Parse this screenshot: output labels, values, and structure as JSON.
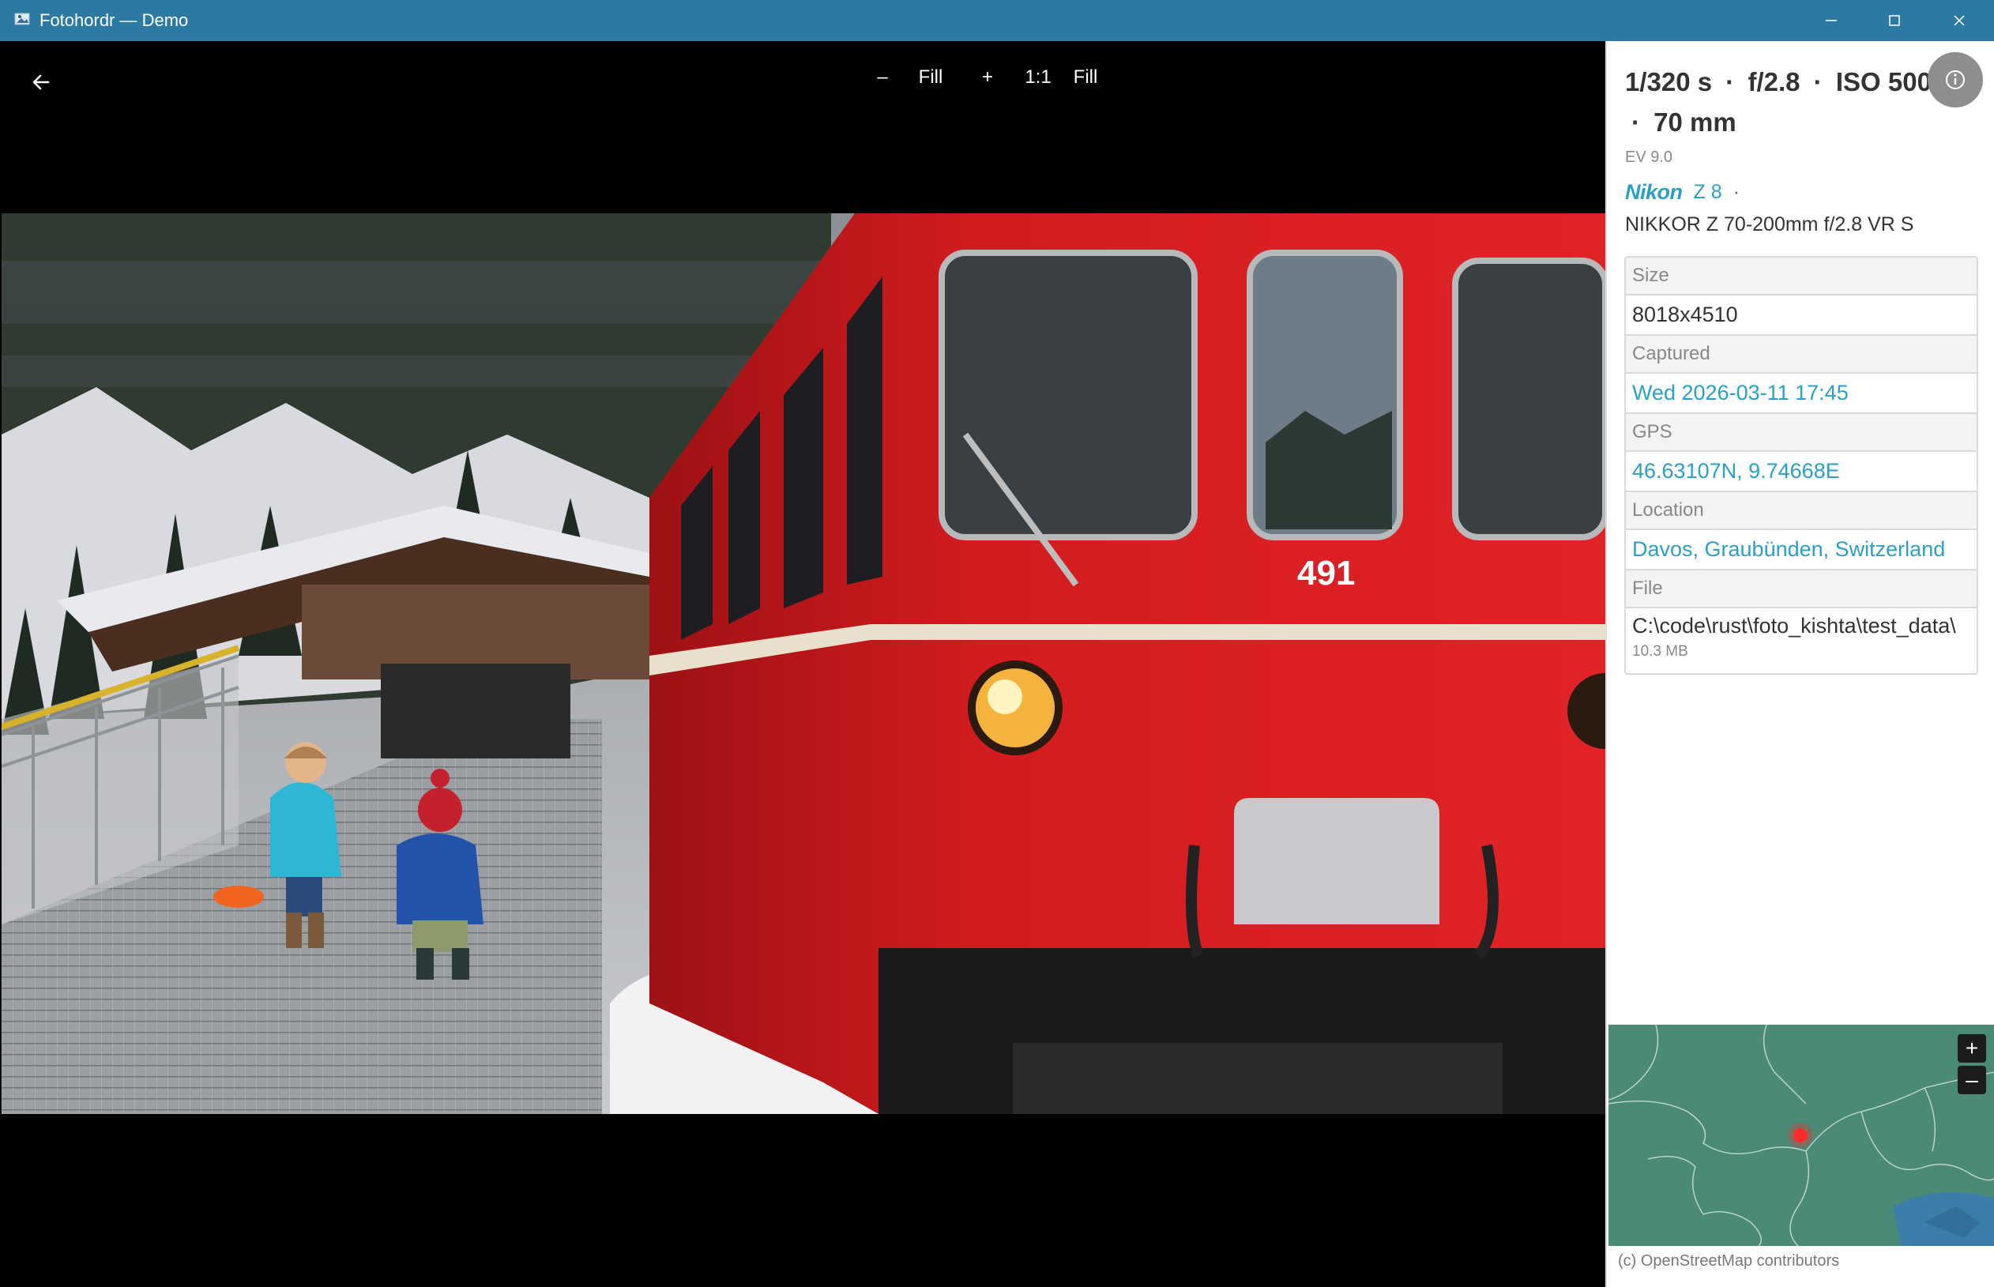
{
  "window": {
    "title": "Fotohordr — Demo"
  },
  "toolbar": {
    "zoom_out": "–",
    "fill_1": "Fill",
    "zoom_in": "+",
    "one_to_one": "1:1",
    "fill_2": "Fill"
  },
  "exif": {
    "shutter": "1/320 s",
    "aperture": "f/2.8",
    "iso": "ISO 500",
    "focal": "70 mm",
    "separator": "·",
    "ev": "EV 9.0",
    "camera_brand": "Nikon",
    "camera_model": "Z 8",
    "camera_dot": "·",
    "lens": "NIKKOR Z 70-200mm f/2.8 VR S"
  },
  "meta": {
    "size_label": "Size",
    "size_value": "8018x4510",
    "captured_label": "Captured",
    "captured_value": "Wed 2026-03-11 17:45",
    "gps_label": "GPS",
    "gps_value": "46.63107N, 9.74668E",
    "location_label": "Location",
    "location_value": "Davos, Graubünden, Switzerland",
    "file_label": "File",
    "file_path": "C:\\code\\rust\\foto_kishta\\test_data\\",
    "file_size": "10.3 MB"
  },
  "map": {
    "zoom_in": "+",
    "zoom_out": "–",
    "attribution": "(c) OpenStreetMap contributors"
  },
  "colors": {
    "titlebar": "#2c7aa3",
    "accent": "#2aa0c8",
    "train_red": "#d31c1f",
    "map_green": "#4a8a76",
    "map_marker": "#ff2a2a"
  },
  "icons": {
    "back": "arrow-left-icon",
    "info": "info-icon",
    "minimize": "minimize-icon",
    "maximize": "maximize-icon",
    "close": "close-icon",
    "marker": "location-marker-icon"
  }
}
